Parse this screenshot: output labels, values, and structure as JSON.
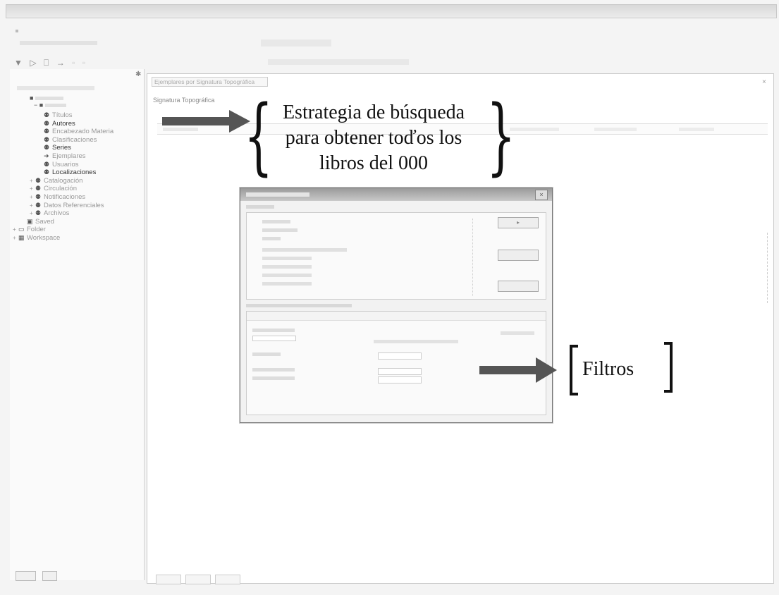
{
  "window": {
    "toolbar_icons": [
      "▼",
      "▷",
      "⎕",
      "→",
      "▫",
      "▫"
    ]
  },
  "left_panel": {
    "tree": [
      {
        "label": "Títulos",
        "icon": "binoculars-icon",
        "tone": "light",
        "indent": 3
      },
      {
        "label": "Autores",
        "icon": "binoculars-icon",
        "tone": "dark",
        "indent": 3
      },
      {
        "label": "Encabezado Materia",
        "icon": "binoculars-icon",
        "tone": "light",
        "indent": 3
      },
      {
        "label": "Clasificaciones",
        "icon": "binoculars-icon",
        "tone": "light",
        "indent": 3
      },
      {
        "label": "Series",
        "icon": "binoculars-icon",
        "tone": "dark",
        "indent": 3
      },
      {
        "label": "Ejemplares",
        "icon": "arrow-icon",
        "tone": "light",
        "indent": 3
      },
      {
        "label": "Usuarios",
        "icon": "binoculars-icon",
        "tone": "light",
        "indent": 3
      },
      {
        "label": "Localizaciones",
        "icon": "binoculars-icon",
        "tone": "dark",
        "indent": 3
      },
      {
        "label": "Catalogación",
        "icon": "binoculars-icon",
        "tone": "light",
        "indent": 2,
        "toggle": "+"
      },
      {
        "label": "Circulación",
        "icon": "binoculars-icon",
        "tone": "light",
        "indent": 2,
        "toggle": "+"
      },
      {
        "label": "Notificaciones",
        "icon": "binoculars-icon",
        "tone": "light",
        "indent": 2,
        "toggle": "+"
      },
      {
        "label": "Datos Referenciales",
        "icon": "binoculars-icon",
        "tone": "light",
        "indent": 2,
        "toggle": "+"
      },
      {
        "label": "Archivos",
        "icon": "binoculars-icon",
        "tone": "light",
        "indent": 2,
        "toggle": "+"
      },
      {
        "label": "Saved",
        "icon": "saved-icon",
        "tone": "light",
        "indent": 1
      },
      {
        "label": "Folder",
        "icon": "folder-icon",
        "tone": "light",
        "indent": 0,
        "toggle": "+"
      },
      {
        "label": "Workspace",
        "icon": "workspace-icon",
        "tone": "light",
        "indent": 0,
        "toggle": "+"
      }
    ]
  },
  "main": {
    "doc_tab": "Ejemplares por Signatura Topográfica",
    "section_title": "Signatura Topográfica"
  },
  "annotations": {
    "strategy_lines": [
      "Estrategia de búsqueda",
      "para obtener toďos los",
      "libros del 000"
    ],
    "filters": "Filtros"
  },
  "colors": {
    "arrow": "#555555",
    "annotation_text": "#111111"
  }
}
